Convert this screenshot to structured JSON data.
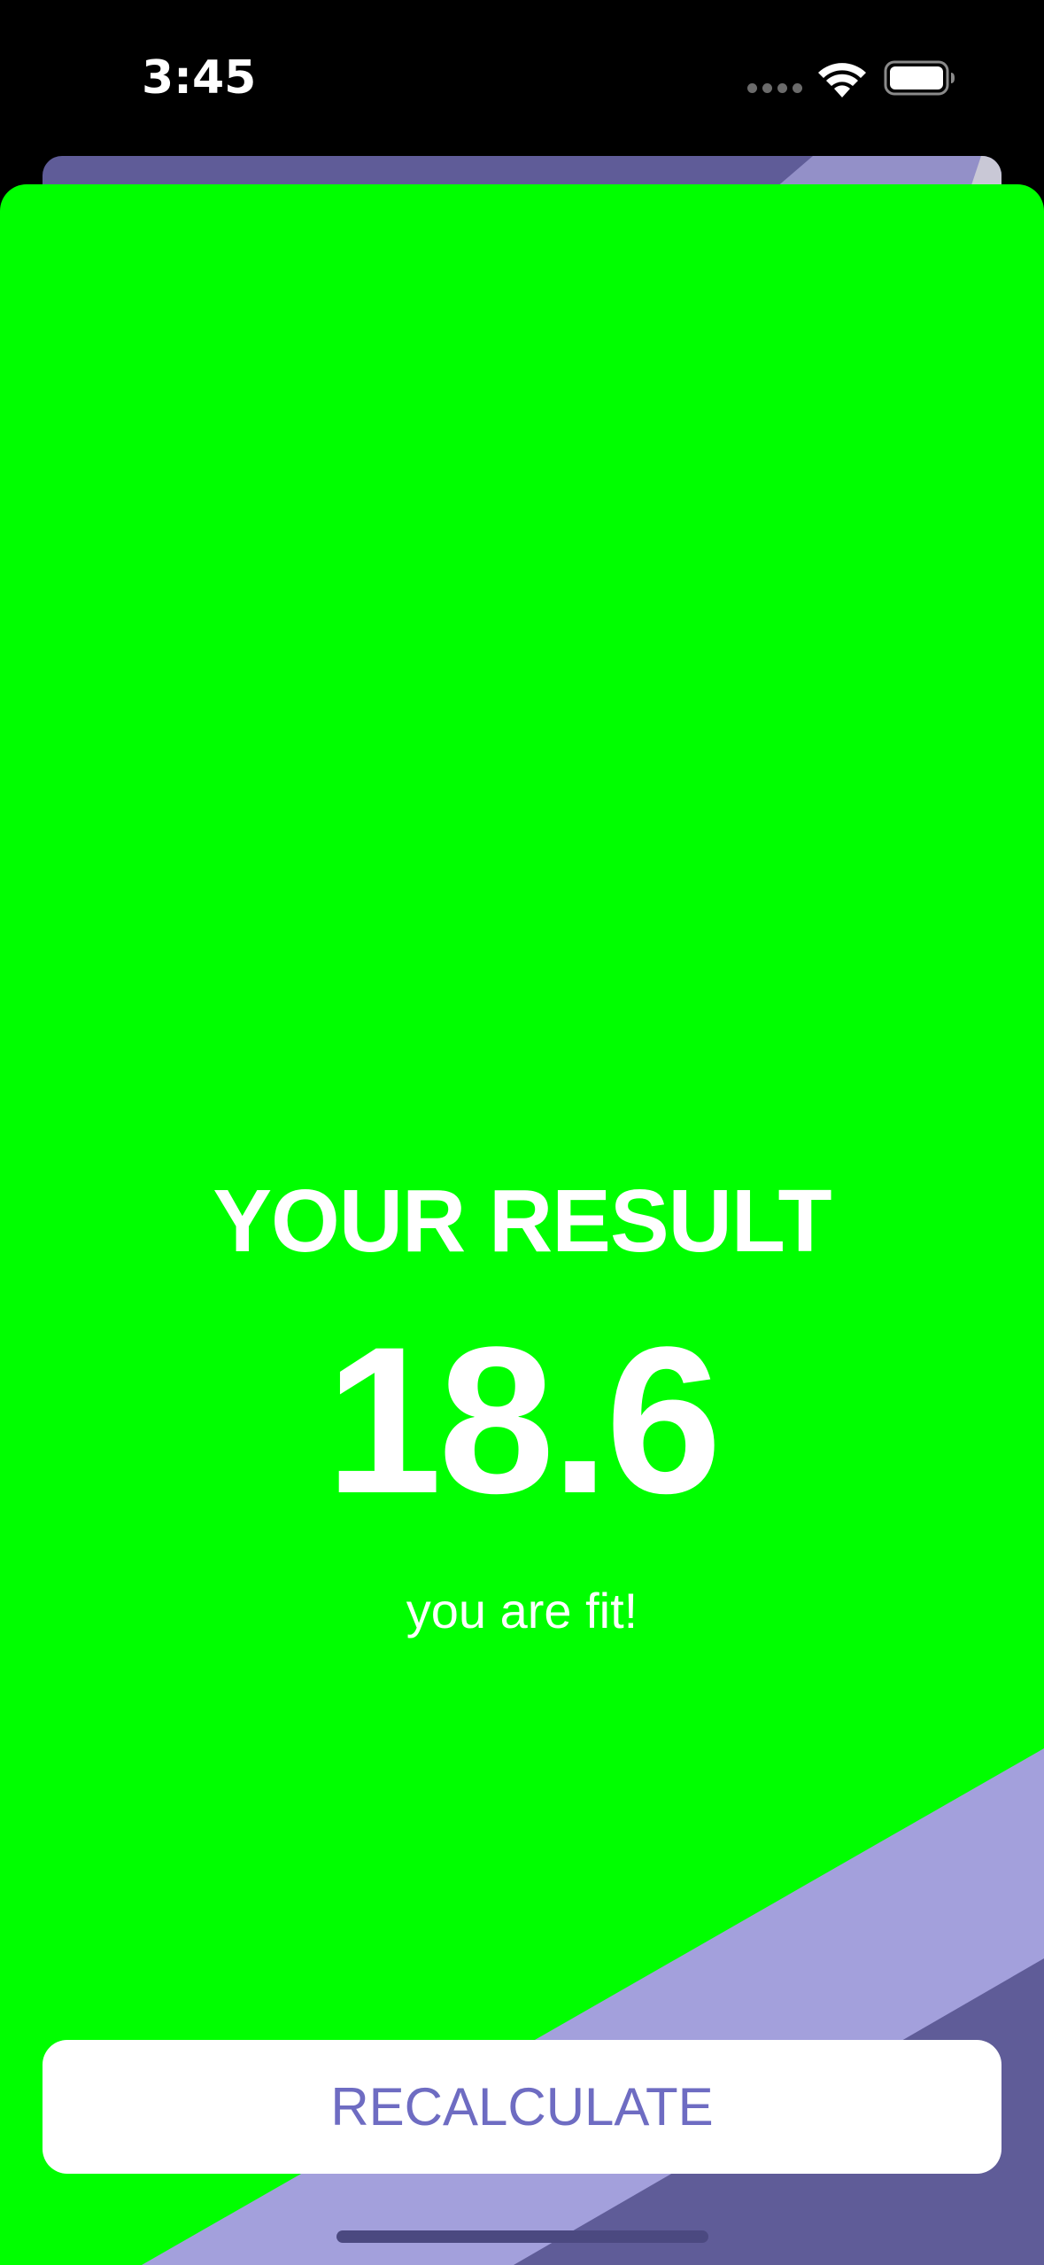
{
  "status_bar": {
    "time": "3:45",
    "signal_icon": "cellular-dots-icon",
    "wifi_icon": "wifi-icon",
    "battery_icon": "battery-icon"
  },
  "result": {
    "title": "YOUR RESULT",
    "value": "18.6",
    "message": "you are fit!"
  },
  "actions": {
    "recalculate_label": "RECALCULATE"
  },
  "colors": {
    "background": "#00ff00",
    "accent": "#6e6cc2",
    "stripe_light": "#a3a0dc",
    "stripe_dark": "#5f5c98",
    "text": "#ffffff"
  }
}
